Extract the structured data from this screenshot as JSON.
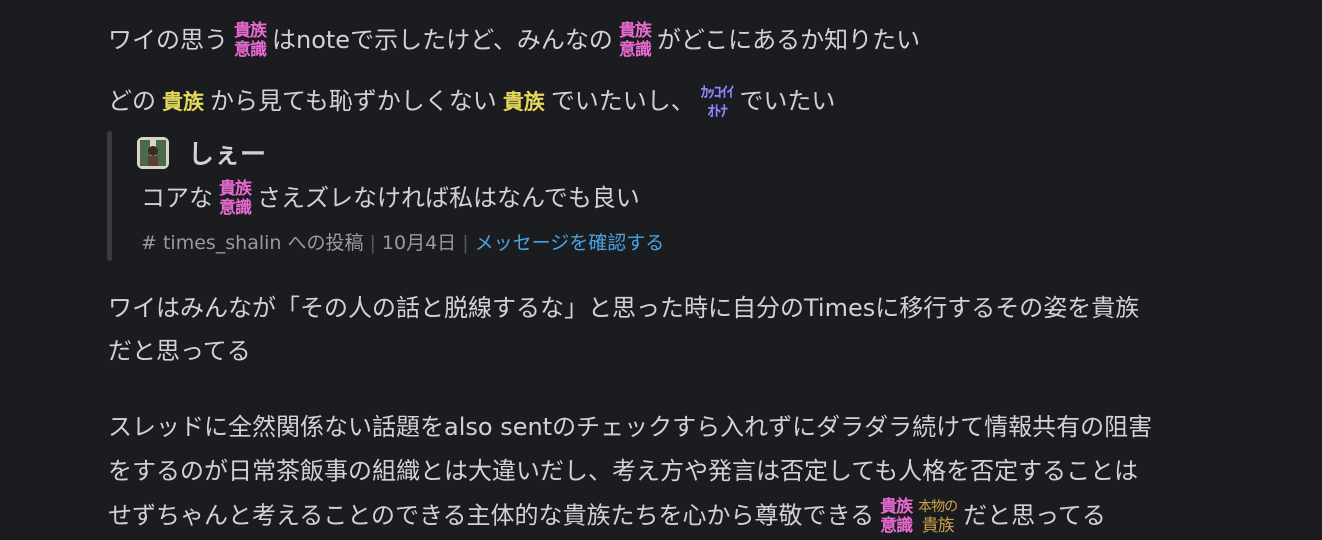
{
  "line1": {
    "a": "ワイの思う",
    "b": "はnoteで示したけど、みんなの",
    "c": "がどこにあるか知りたい"
  },
  "line2": {
    "a": "どの",
    "b": "から見ても恥ずかしくない",
    "c": "でいたいし、",
    "d": "でいたい"
  },
  "emoji": {
    "kizoku_ishiki_top": "貴族",
    "kizoku_ishiki_bottom": "意識",
    "kizoku": "貴族",
    "kakkoii_top": "ｶｯｺｲｲ",
    "kakkoii_bottom": "ｵﾄﾅ",
    "honmono_top": "本物の",
    "honmono_bottom": "貴族"
  },
  "quote": {
    "author": "しぇー",
    "text_a": "コアな",
    "text_b": "さえズレなければ私はなんでも良い",
    "channel": "# times_shalin への投稿",
    "date": "10月4日",
    "link": "メッセージを確認する"
  },
  "para1": {
    "l1": "ワイはみんなが「その人の話と脱線するな」と思った時に自分のTimesに移行するその姿を貴族",
    "l2": "だと思ってる"
  },
  "para2": {
    "l1": "スレッドに全然関係ない話題をalso sentのチェックすら入れずにダラダラ続けて情報共有の阻害",
    "l2": "をするのが日常茶飯事の組織とは大違いだし、考え方や発言は否定しても人格を否定することは",
    "l3a": "せずちゃんと考えることのできる主体的な貴族たちを心から尊敬できる",
    "l3b": "だと思ってる"
  }
}
